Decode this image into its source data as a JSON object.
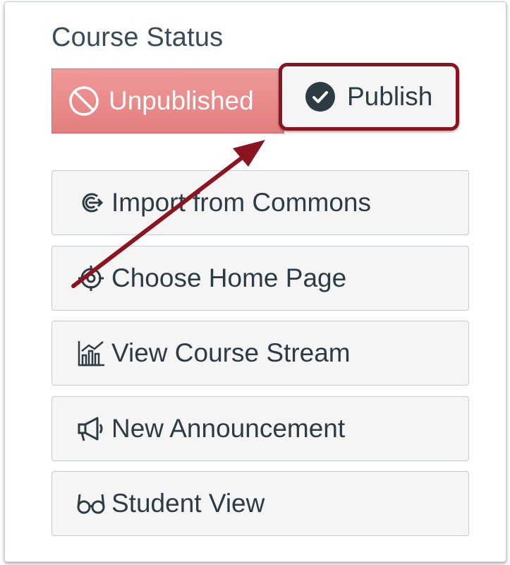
{
  "panel": {
    "title": "Course Status"
  },
  "status": {
    "unpublished_label": "Unpublished",
    "unpublished_icon": "cancel-circle-icon",
    "publish_label": "Publish",
    "publish_icon": "check-circle-icon"
  },
  "actions": [
    {
      "label": "Import from Commons",
      "icon": "commons-icon"
    },
    {
      "label": "Choose Home Page",
      "icon": "target-icon"
    },
    {
      "label": "View Course Stream",
      "icon": "stats-chart-icon"
    },
    {
      "label": "New Announcement",
      "icon": "megaphone-icon"
    },
    {
      "label": "Student View",
      "icon": "glasses-icon"
    }
  ],
  "colors": {
    "unpublished_bg": "#e88585",
    "highlight_border": "#8a1521",
    "annotation_arrow": "#8a1521",
    "button_bg": "#f5f5f5",
    "text": "#2d3b45"
  }
}
